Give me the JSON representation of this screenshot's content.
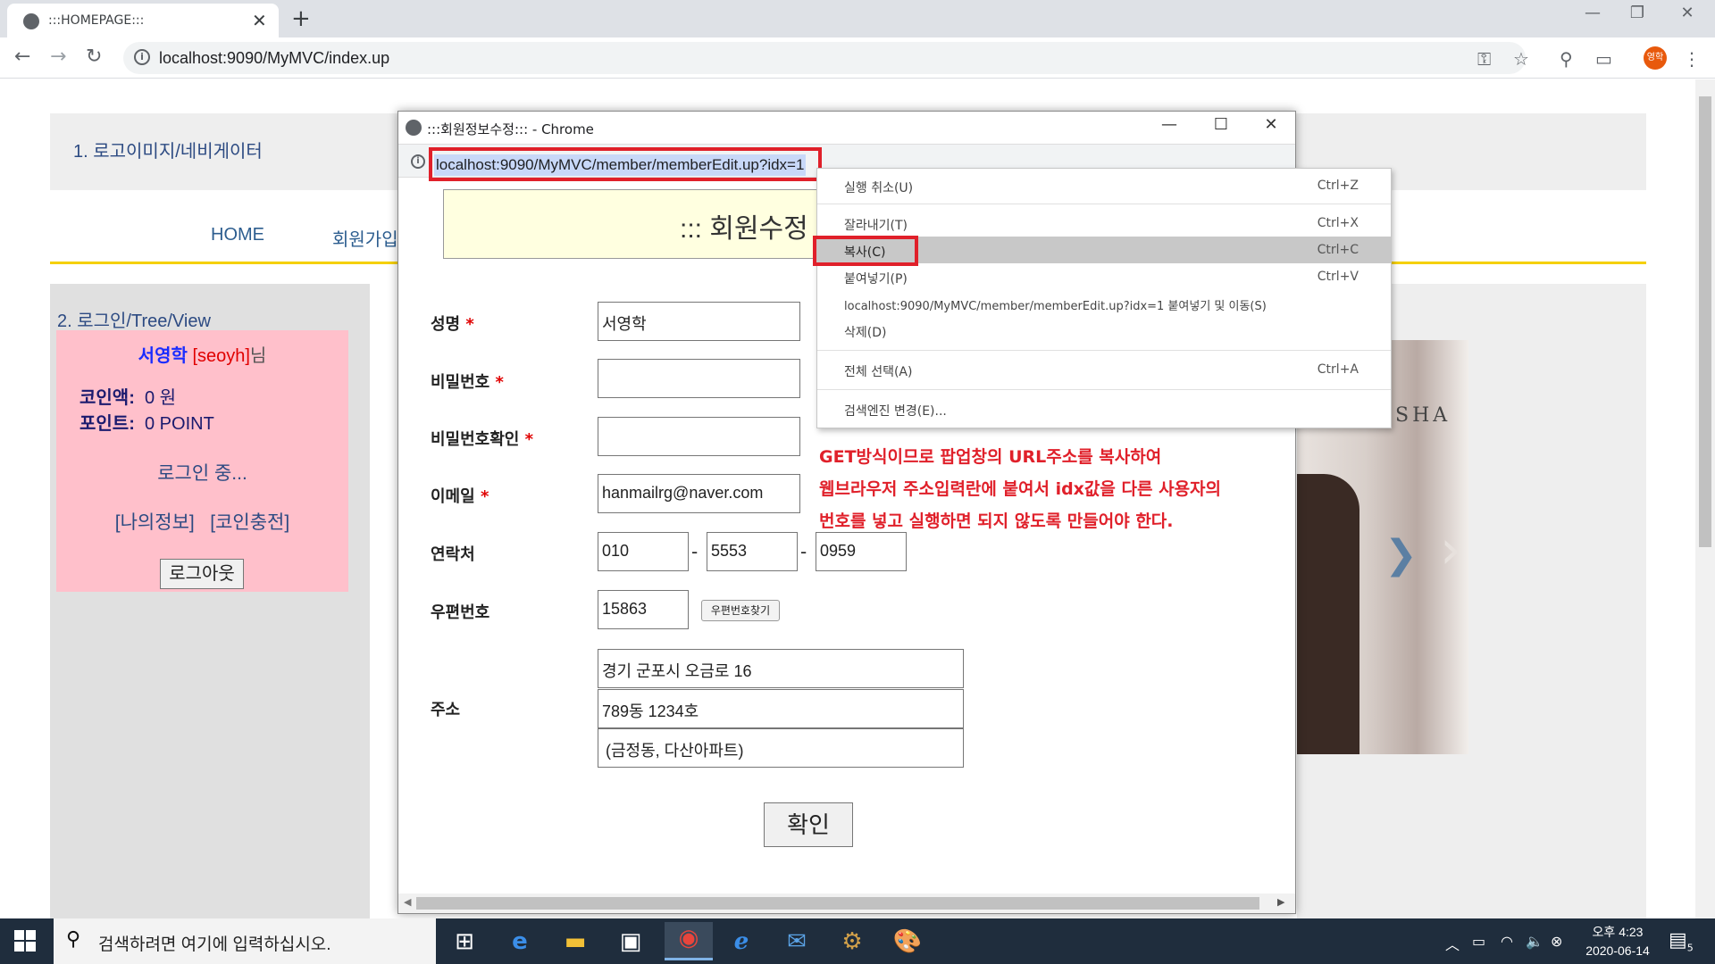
{
  "browser": {
    "tab_title": ":::HOMEPAGE:::",
    "tab_close": "✕",
    "new_tab": "+",
    "url": "localhost:9090/MyMVC/index.up",
    "profile_label": "영학",
    "info_glyph": "i"
  },
  "page": {
    "header_text": "1. 로고이미지/네비게이터",
    "nav": [
      "HOME",
      "회원가입"
    ],
    "side_title": "2. 로그인/Tree/View",
    "login": {
      "name": "서영학",
      "userid": "[seoyh]",
      "suffix": "님",
      "coin_label": "코인액:",
      "coin_value": "0 원",
      "point_label": "포인트:",
      "point_value": "0 POINT",
      "status": "로그인 중...",
      "link_myinfo": "[나의정보]",
      "link_coin": "[코인충전]",
      "logout_button": "로그아웃"
    },
    "banner_brand": "SHA",
    "banner_arrow": "❯"
  },
  "popup": {
    "window_title": ":::회원정보수정::: - Chrome",
    "url": "localhost:9090/MyMVC/member/memberEdit.up?idx=1",
    "form_title": "::: 회원수정",
    "fields": {
      "name_label": "성명",
      "name_value": "서영학",
      "pw_label": "비밀번호",
      "pwcheck_label": "비밀번호확인",
      "email_label": "이메일",
      "email_value": "hanmailrg@naver.com",
      "phone_label": "연락처",
      "phone1": "010",
      "phone2": "5553",
      "phone3": "0959",
      "zip_label": "우편번호",
      "zip_value": "15863",
      "zip_button": "우편번호찾기",
      "addr_label": "주소",
      "addr1": "경기 군포시 오금로 16",
      "addr2": "789동 1234호",
      "addr3": "(금정동, 다산아파트)",
      "required_mark": "*",
      "dash": "-"
    },
    "submit_button": "확인",
    "annotation": [
      "GET방식이므로 팝업창의 URL주소를 복사하여",
      "웹브라우저 주소입력란에 붙여서 idx값을 다른 사용자의",
      "번호를 넣고 실행하면 되지 않도록 만들어야 한다."
    ]
  },
  "context_menu": {
    "items": [
      {
        "label": "실행 취소(U)",
        "shortcut": "Ctrl+Z"
      },
      {
        "label": "잘라내기(T)",
        "shortcut": "Ctrl+X"
      },
      {
        "label": "복사(C)",
        "shortcut": "Ctrl+C"
      },
      {
        "label": "붙여넣기(P)",
        "shortcut": "Ctrl+V"
      },
      {
        "label": "localhost:9090/MyMVC/member/memberEdit.up?idx=1 붙여넣기 및 이동(S)",
        "shortcut": ""
      },
      {
        "label": "삭제(D)",
        "shortcut": ""
      },
      {
        "label": "전체 선택(A)",
        "shortcut": "Ctrl+A"
      },
      {
        "label": "검색엔진 변경(E)...",
        "shortcut": ""
      }
    ]
  },
  "taskbar": {
    "search_placeholder": "검색하려면 여기에 입력하십시오.",
    "time": "오후 4:23",
    "date": "2020-06-14",
    "notification_count": "5"
  },
  "colors": {
    "annotation_red": "#e0202a",
    "nav_blue": "#2c5d8f",
    "login_pink": "#ffc0cb",
    "divider_yellow": "#f5d000"
  }
}
